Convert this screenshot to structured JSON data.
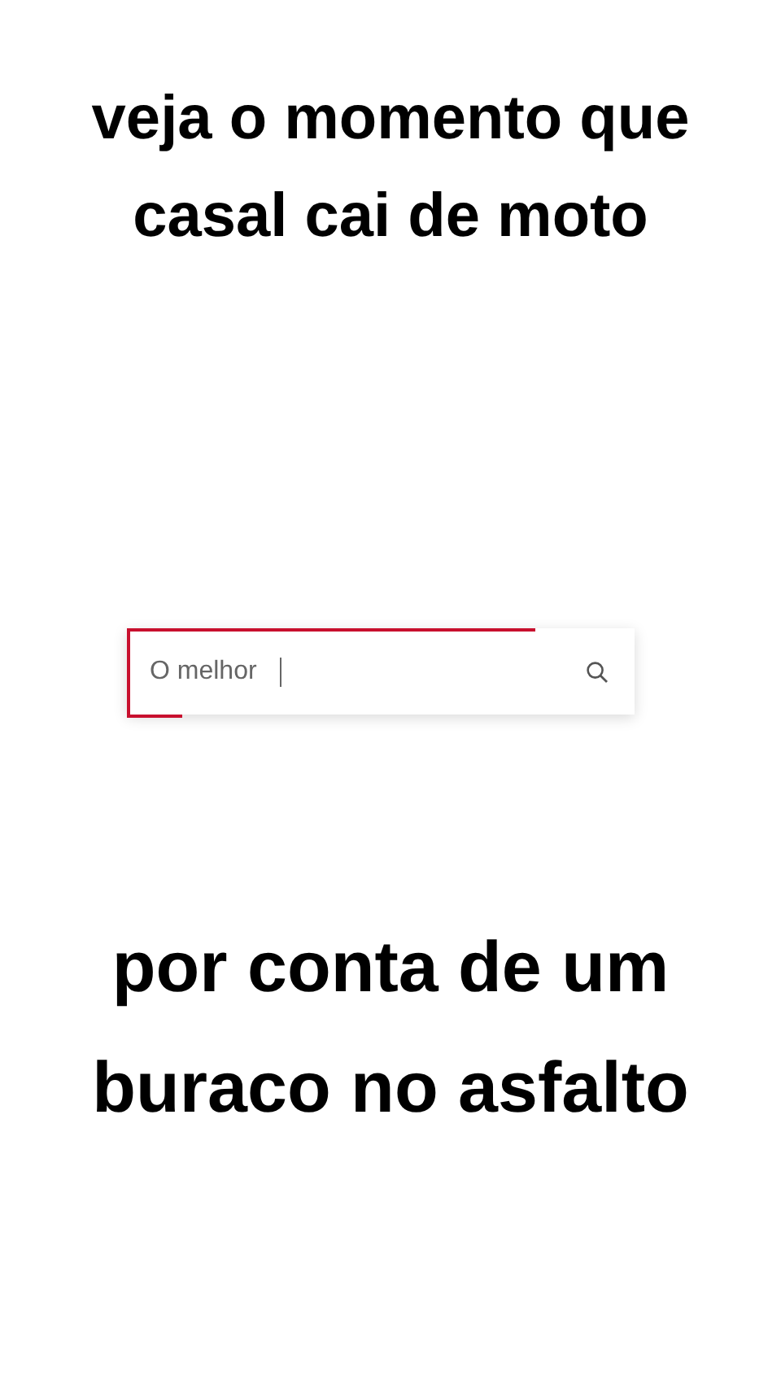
{
  "top_caption": [
    "veja o momento que",
    "casal cai de moto"
  ],
  "search": {
    "value": "O melhor"
  },
  "bottom_caption": [
    "por conta de um",
    "buraco no asfalto"
  ]
}
